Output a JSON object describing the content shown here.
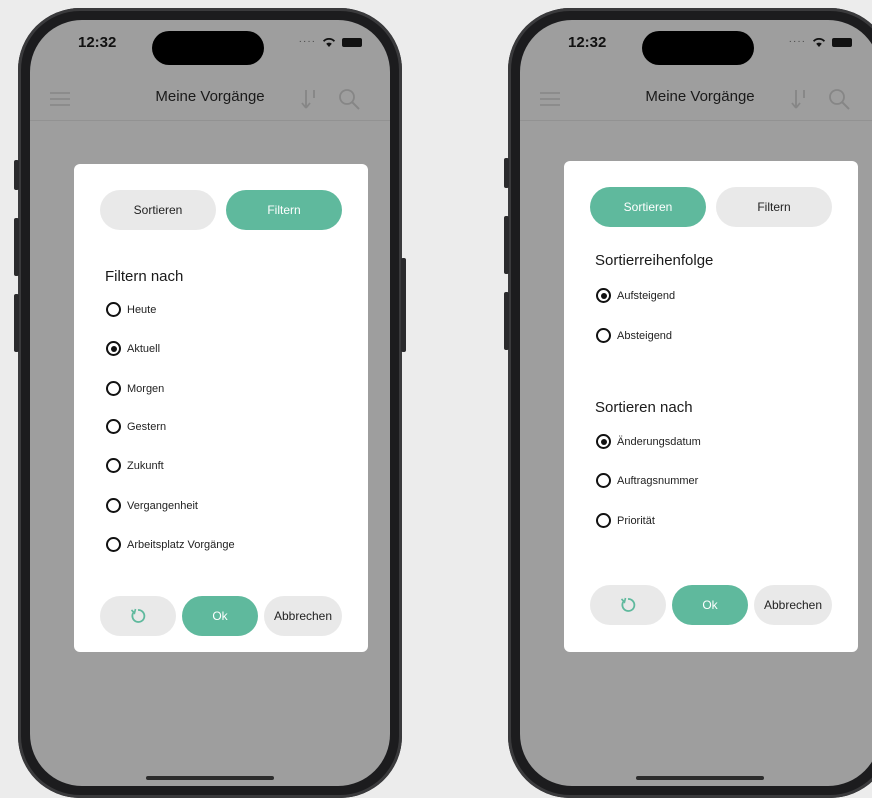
{
  "colors": {
    "accent": "#5fb99d",
    "overlay": "#9e9e9e",
    "inactive_button": "#e9e9e9"
  },
  "left_phone": {
    "status": {
      "time": "12:32"
    },
    "navbar": {
      "title": "Meine Vorgänge",
      "icons": [
        "menu-icon",
        "sort-icon",
        "search-icon"
      ]
    },
    "dialog": {
      "tabs": [
        {
          "label": "Sortieren",
          "active": false
        },
        {
          "label": "Filtern",
          "active": true
        }
      ],
      "section_title": "Filtern nach",
      "options": [
        {
          "label": "Heute",
          "checked": false
        },
        {
          "label": "Aktuell",
          "checked": true
        },
        {
          "label": "Morgen",
          "checked": false
        },
        {
          "label": "Gestern",
          "checked": false
        },
        {
          "label": "Zukunft",
          "checked": false
        },
        {
          "label": "Vergangenheit",
          "checked": false
        },
        {
          "label": "Arbeitsplatz Vorgänge",
          "checked": false
        }
      ],
      "actions": {
        "reset_icon": "reset-icon",
        "ok_label": "Ok",
        "cancel_label": "Abbrechen"
      }
    }
  },
  "right_phone": {
    "status": {
      "time": "12:32"
    },
    "navbar": {
      "title": "Meine Vorgänge",
      "icons": [
        "menu-icon",
        "sort-icon",
        "search-icon"
      ]
    },
    "dialog": {
      "tabs": [
        {
          "label": "Sortieren",
          "active": true
        },
        {
          "label": "Filtern",
          "active": false
        }
      ],
      "order_title": "Sortierreihenfolge",
      "order_options": [
        {
          "label": "Aufsteigend",
          "checked": true
        },
        {
          "label": "Absteigend",
          "checked": false
        }
      ],
      "sortby_title": "Sortieren nach",
      "sortby_options": [
        {
          "label": "Änderungsdatum",
          "checked": true
        },
        {
          "label": "Auftragsnummer",
          "checked": false
        },
        {
          "label": "Priorität",
          "checked": false
        }
      ],
      "actions": {
        "reset_icon": "reset-icon",
        "ok_label": "Ok",
        "cancel_label": "Abbrechen"
      }
    }
  }
}
